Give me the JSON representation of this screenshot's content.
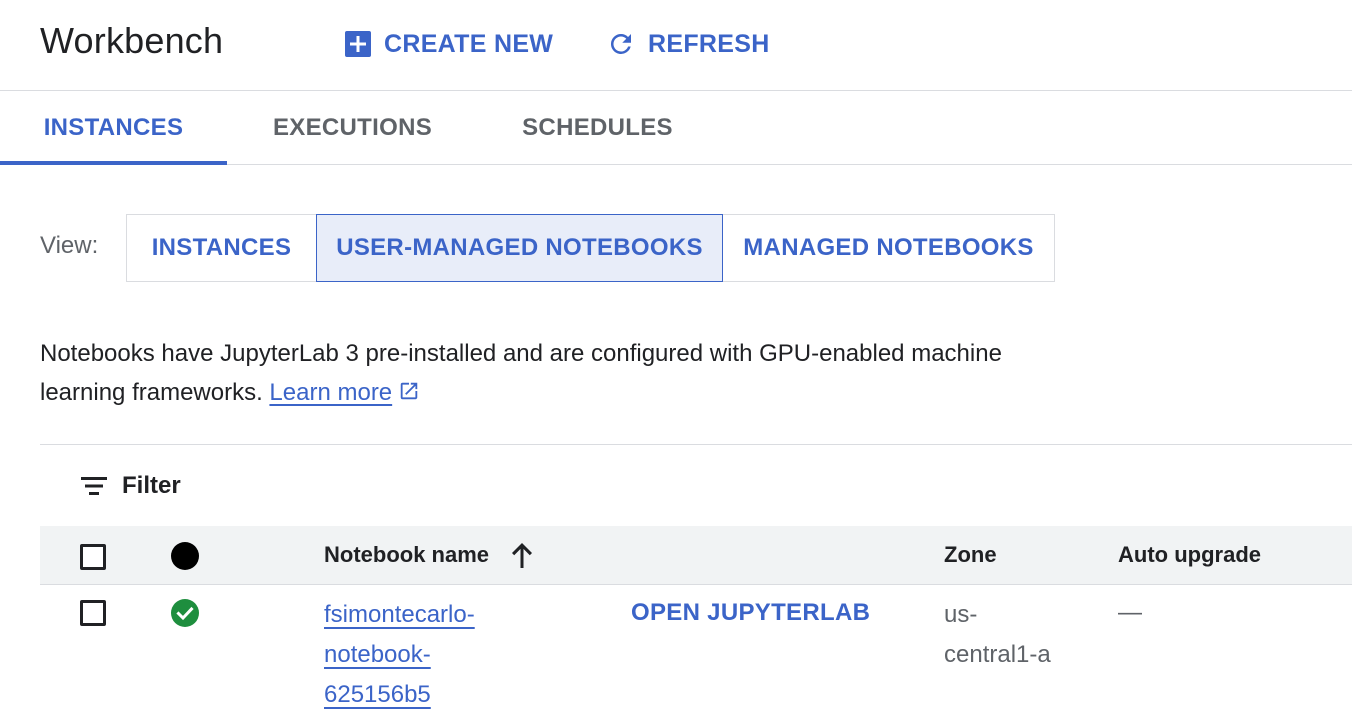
{
  "header": {
    "title": "Workbench",
    "create_label": "CREATE NEW",
    "refresh_label": "REFRESH"
  },
  "tabs": [
    {
      "label": "INSTANCES",
      "active": true
    },
    {
      "label": "EXECUTIONS",
      "active": false
    },
    {
      "label": "SCHEDULES",
      "active": false
    }
  ],
  "view": {
    "label": "View:",
    "options": [
      {
        "label": "INSTANCES",
        "selected": false
      },
      {
        "label": "USER-MANAGED NOTEBOOKS",
        "selected": true
      },
      {
        "label": "MANAGED NOTEBOOKS",
        "selected": false
      }
    ]
  },
  "description": {
    "text": "Notebooks have JupyterLab 3 pre-installed and are configured with GPU-enabled machine learning frameworks.",
    "link_label": "Learn more"
  },
  "filter": {
    "label": "Filter"
  },
  "table": {
    "columns": {
      "name": "Notebook name",
      "zone": "Zone",
      "auto_upgrade": "Auto upgrade"
    },
    "rows": [
      {
        "status": "running",
        "name": "fsimontecarlo-notebook-625156b5",
        "action": "OPEN JUPYTERLAB",
        "zone": "us-central1-a",
        "auto_upgrade": "—"
      }
    ]
  },
  "colors": {
    "accent": "#3b64c8",
    "status_ok": "#1e8e3e",
    "selected_bg": "#e8edf9"
  },
  "icons": {
    "create": "add-box-icon",
    "refresh": "refresh-icon",
    "external": "open-in-new-icon",
    "filter": "filter-list-icon",
    "sort": "arrow-upward-icon",
    "status": "check-circle-icon"
  }
}
